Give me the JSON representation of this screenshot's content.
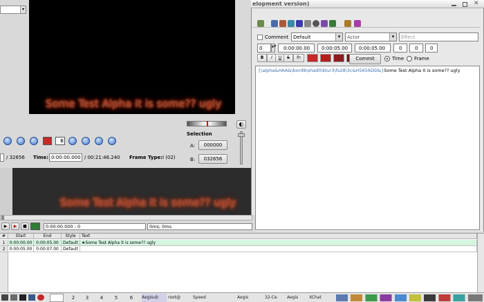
{
  "window_title": "elopment version)",
  "video": {
    "subtitle_top": "Some Test Alpha it is some?? ugly",
    "subtitle_bottom": "Some Test Alpha it is some?? ugly"
  },
  "frame": {
    "total_frames": "/ 32656",
    "time_label": "Time:",
    "time_value": "0:00:00.000",
    "total_time": "/ 00:21:46.240",
    "frame_type_label": "Frame Type:",
    "frame_type_value": "I (02)"
  },
  "selection": {
    "label": "Selection",
    "a_label": "A:",
    "a_value": "000000",
    "b_label": "B:",
    "b_value": "032656"
  },
  "edit": {
    "comment_label": "Comment",
    "style_value": "Default",
    "actor_placeholder": "Actor",
    "effect_placeholder": "Effect",
    "layer": "0",
    "start_time": "0:00:00.00",
    "end_time": "0:00:05.00",
    "duration": "0:00:05.00",
    "margin_l": "0",
    "margin_r": "0",
    "margin_v": "0",
    "bold": "B",
    "italic": "I",
    "underline": "U",
    "strike": "S",
    "font": "fn",
    "commit_label": "Commit",
    "time_label": "Time",
    "frame_label": "Frame",
    "text_override": "{\\alpha&HAA&\\bord9\\shad0\\blur3\\fs28\\3c&H5656DD&}",
    "text_plain": "Some Test Alpha it is some?? ugly"
  },
  "audio": {
    "time_value": "0:00:00.000 - 0",
    "ms_value": "0ms; 0ms"
  },
  "grid": {
    "headers": [
      "#",
      "Start",
      "End",
      "Style",
      "Text"
    ],
    "rows": [
      {
        "num": "1",
        "start": "0:00:00.00",
        "end": "0:00:05.00",
        "style": "Default",
        "text": "★Some Test Alpha it is some?? ugly"
      },
      {
        "num": "2",
        "start": "0:00:05.00",
        "end": "0:00:07.00",
        "style": "Default",
        "text": ""
      }
    ]
  },
  "taskbar": {
    "workspaces": [
      "2",
      "3",
      "4",
      "5",
      "6"
    ],
    "tasks": [
      "Aegisub",
      "root@",
      "Speed",
      "",
      "Aegis",
      "",
      "32-Ce",
      "Aegis",
      "XChat"
    ]
  },
  "colors": {
    "video_bg": "#000000",
    "grid_selected": "#d6f5e0",
    "taskbar": "#e4e4e4"
  }
}
